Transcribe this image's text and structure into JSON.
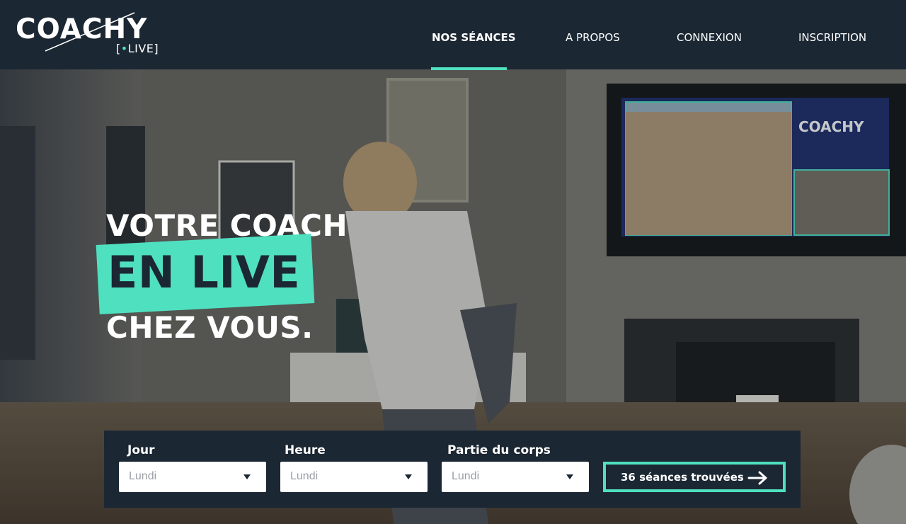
{
  "brand": {
    "name": "COACHY",
    "sub_bracket_open": "[",
    "sub_dot": "•",
    "sub_text": "LIVE]"
  },
  "nav": {
    "items": [
      {
        "label": "NOS SÉANCES",
        "active": true
      },
      {
        "label": "A PROPOS",
        "active": false
      },
      {
        "label": "CONNEXION",
        "active": false
      },
      {
        "label": "INSCRIPTION",
        "active": false
      }
    ]
  },
  "hero": {
    "line1": "VOTRE COACH",
    "line2": "EN LIVE",
    "line3": "CHEZ VOUS."
  },
  "filters": {
    "jour": {
      "label": "Jour",
      "value": "Lundi"
    },
    "heure": {
      "label": "Heure",
      "value": "Lundi"
    },
    "partie": {
      "label": "Partie du corps",
      "value": "Lundi"
    },
    "results_label": "36 séances trouvées"
  },
  "colors": {
    "accent": "#4fe0c0",
    "navy": "#1b2733",
    "white": "#ffffff"
  },
  "icons": {
    "select_caret": "caret-down-icon",
    "results_arrow": "arrow-right-icon"
  }
}
